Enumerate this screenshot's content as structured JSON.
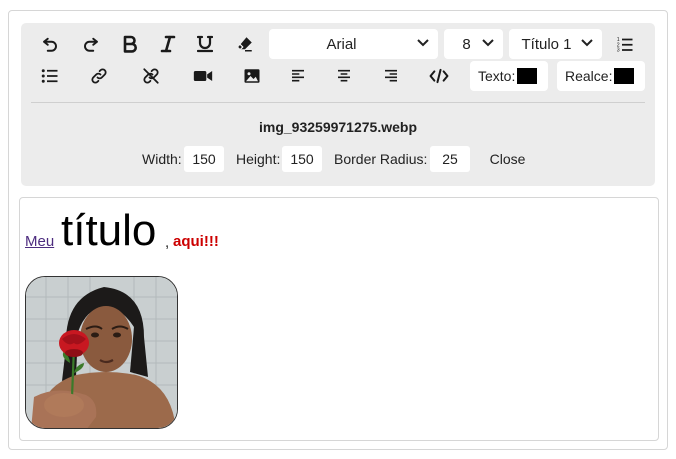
{
  "toolbar": {
    "font_family": "Arial",
    "font_size": "8",
    "block_format": "Título 1",
    "text_color_label": "Texto:",
    "highlight_label": "Realce:",
    "text_color": "#000000",
    "highlight_color": "#000000"
  },
  "image_panel": {
    "filename": "img_93259971275.webp",
    "width_label": "Width:",
    "width_value": "150",
    "height_label": "Height:",
    "height_value": "150",
    "radius_label": "Border Radius:",
    "radius_value": "25",
    "close_label": "Close"
  },
  "editor": {
    "link_text": "Meu ",
    "heading_text": "título",
    "separator_text": ",",
    "emphasis_text": "aqui!!!"
  },
  "colors": {
    "toolbar_bg": "#ececec",
    "link": "#4d2c7f",
    "emphasis": "#cc0000"
  }
}
